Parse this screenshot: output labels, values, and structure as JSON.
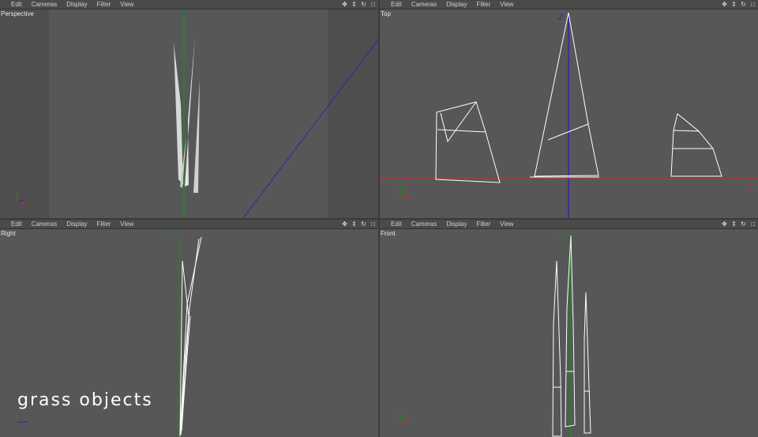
{
  "menus": [
    "Edit",
    "Cameras",
    "Display",
    "Filter",
    "View"
  ],
  "controls": [
    "move-icon",
    "dolly-icon",
    "rotate-icon",
    "maximize-icon"
  ],
  "viewports": {
    "perspective": {
      "label": "Perspective"
    },
    "top": {
      "label": "Top"
    },
    "right": {
      "label": "Right"
    },
    "front": {
      "label": "Front"
    }
  },
  "axis_labels": {
    "x": "X",
    "y": "Y",
    "z": "Z"
  },
  "caption": "grass objects",
  "colors": {
    "x_axis": "#c03030",
    "y_axis": "#1e8a1e",
    "z_axis": "#2a2aa0",
    "wire": "#ffffff"
  }
}
